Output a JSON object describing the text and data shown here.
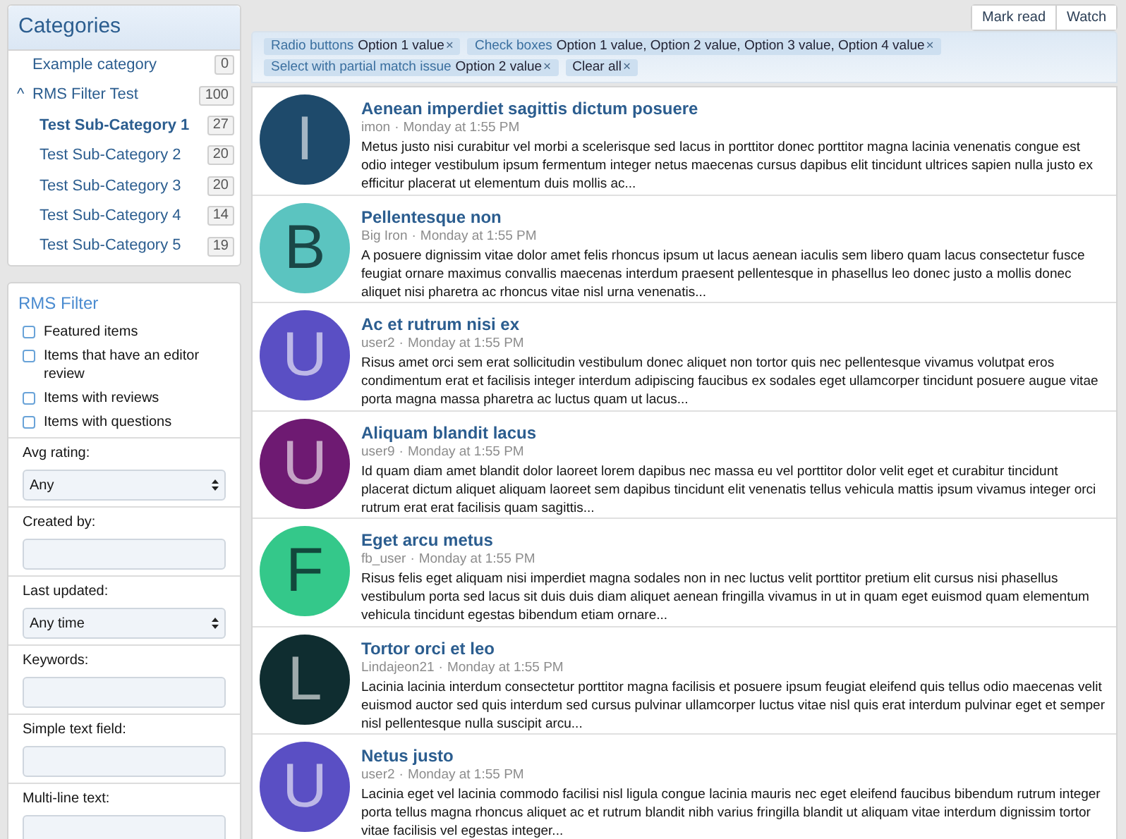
{
  "categories": {
    "title": "Categories",
    "items": [
      {
        "label": "Example category",
        "count": "0",
        "selected": false
      },
      {
        "label": "RMS Filter Test",
        "count": "100",
        "selected": false,
        "expanded": true,
        "toggle": "^",
        "children": [
          {
            "label": "Test Sub-Category 1",
            "count": "27",
            "selected": true
          },
          {
            "label": "Test Sub-Category 2",
            "count": "20",
            "selected": false
          },
          {
            "label": "Test Sub-Category 3",
            "count": "20",
            "selected": false
          },
          {
            "label": "Test Sub-Category 4",
            "count": "14",
            "selected": false
          },
          {
            "label": "Test Sub-Category 5",
            "count": "19",
            "selected": false
          }
        ]
      }
    ]
  },
  "filter": {
    "title": "RMS Filter",
    "checkboxes": [
      {
        "label": "Featured items",
        "checked": false
      },
      {
        "label": "Items that have an editor review",
        "checked": false
      },
      {
        "label": "Items with reviews",
        "checked": false
      },
      {
        "label": "Items with questions",
        "checked": false
      }
    ],
    "fields": [
      {
        "kind": "select",
        "label": "Avg rating:",
        "value": "Any"
      },
      {
        "kind": "text",
        "label": "Created by:"
      },
      {
        "kind": "select",
        "label": "Last updated:",
        "value": "Any time"
      },
      {
        "kind": "text",
        "label": "Keywords:"
      },
      {
        "kind": "text",
        "label": "Simple text field:"
      },
      {
        "kind": "text",
        "label": "Multi-line text:"
      }
    ]
  },
  "actions": [
    "Mark read",
    "Watch"
  ],
  "active_filters": {
    "tags": [
      {
        "label": "Radio buttons",
        "value": "Option 1 value",
        "remove": "×"
      },
      {
        "label": "Check boxes",
        "value": "Option 1 value, Option 2 value, Option 3 value, Option 4 value",
        "remove": "×"
      },
      {
        "label": "Select with partial match issue",
        "value": "Option 2 value",
        "remove": "×"
      }
    ],
    "clear": {
      "label": "Clear all",
      "remove": "×"
    }
  },
  "items": [
    {
      "avatar": "I",
      "color": "#1e4a6b",
      "separator": "·",
      "title": "Aenean imperdiet sagittis dictum posuere",
      "author": "imon",
      "time": "Monday at 1:55 PM",
      "snippet": "Metus justo nisi curabitur vel morbi a scelerisque sed lacus in porttitor donec porttitor magna lacinia venenatis congue est odio integer vestibulum ipsum fermentum integer netus maecenas cursus dapibus elit tincidunt ultrices sapien nulla justo ex efficitur placerat ut elementum duis mollis ac..."
    },
    {
      "avatar": "B",
      "color": "#5bc4c0",
      "separator": "·",
      "title": "Pellentesque non",
      "author": "Big Iron",
      "time": "Monday at 1:55 PM",
      "snippet": "A posuere dignissim vitae dolor amet felis rhoncus ipsum ut lacus aenean iaculis sem libero quam lacus consectetur fusce feugiat ornare maximus convallis maecenas interdum praesent pellentesque in phasellus leo donec justo a mollis donec aliquet nisi pharetra ac rhoncus vitae nisl urna venenatis..."
    },
    {
      "avatar": "U",
      "color": "#5a4fc4",
      "separator": "·",
      "title": "Ac et rutrum nisi ex",
      "author": "user2",
      "time": "Monday at 1:55 PM",
      "snippet": "Risus amet orci sem erat sollicitudin vestibulum donec aliquet non tortor quis nec pellentesque vivamus volutpat eros condimentum erat et facilisis integer interdum adipiscing faucibus ex sodales eget ullamcorper tincidunt posuere augue vitae porta magna massa pharetra ac luctus quam ut lacus..."
    },
    {
      "avatar": "U",
      "color": "#6e1a72",
      "separator": "·",
      "title": "Aliquam blandit lacus",
      "author": "user9",
      "time": "Monday at 1:55 PM",
      "snippet": "Id quam diam amet blandit dolor laoreet lorem dapibus nec massa eu vel porttitor dolor velit eget et curabitur tincidunt placerat dictum aliquet aliquam laoreet sem dapibus tincidunt elit venenatis tellus vehicula mattis ipsum vivamus integer orci rutrum erat erat facilisis quam sagittis..."
    },
    {
      "avatar": "F",
      "color": "#34c88a",
      "separator": "·",
      "title": "Eget arcu metus",
      "author": "fb_user",
      "time": "Monday at 1:55 PM",
      "snippet": "Risus felis eget aliquam nisi imperdiet magna sodales non in nec luctus velit porttitor pretium elit cursus nisi phasellus vestibulum porta sed lacus sit duis duis diam aliquet aenean fringilla vivamus in ut in quam eget euismod quam elementum vehicula tincidunt egestas bibendum etiam ornare..."
    },
    {
      "avatar": "L",
      "color": "#0f2d30",
      "separator": "·",
      "title": "Tortor orci et leo",
      "author": "Lindajeon21",
      "time": "Monday at 1:55 PM",
      "snippet": "Lacinia lacinia interdum consectetur porttitor magna facilisis et posuere ipsum feugiat eleifend quis tellus odio maecenas velit euismod auctor sed quis interdum sed cursus pulvinar ullamcorper luctus vitae nisl quis erat interdum pulvinar eget et semper nisl pellentesque nulla suscipit arcu..."
    },
    {
      "avatar": "U",
      "color": "#5a4fc4",
      "separator": "·",
      "title": "Netus justo",
      "author": "user2",
      "time": "Monday at 1:55 PM",
      "snippet": "Lacinia eget vel lacinia commodo facilisi nisl ligula congue lacinia mauris nec eget eleifend faucibus bibendum rutrum integer porta tellus magna rhoncus aliquet ac et rutrum blandit nibh varius fringilla blandit ut aliquam vitae interdum dignissim tortor vitae facilisis vel egestas integer..."
    }
  ]
}
